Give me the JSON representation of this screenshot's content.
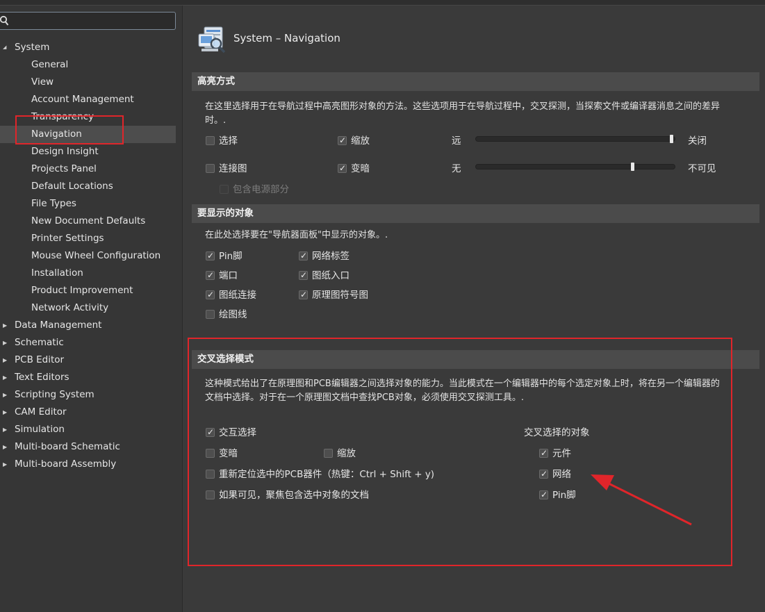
{
  "search": {
    "value": "",
    "placeholder": ""
  },
  "tree": [
    {
      "label": "System",
      "level": 0,
      "expanded": true,
      "selected": false
    },
    {
      "label": "General",
      "level": 1,
      "selected": false
    },
    {
      "label": "View",
      "level": 1,
      "selected": false
    },
    {
      "label": "Account Management",
      "level": 1,
      "selected": false
    },
    {
      "label": "Transparency",
      "level": 1,
      "selected": false
    },
    {
      "label": "Navigation",
      "level": 1,
      "selected": true
    },
    {
      "label": "Design Insight",
      "level": 1,
      "selected": false
    },
    {
      "label": "Projects Panel",
      "level": 1,
      "selected": false
    },
    {
      "label": "Default Locations",
      "level": 1,
      "selected": false
    },
    {
      "label": "File Types",
      "level": 1,
      "selected": false
    },
    {
      "label": "New Document Defaults",
      "level": 1,
      "selected": false
    },
    {
      "label": "Printer Settings",
      "level": 1,
      "selected": false
    },
    {
      "label": "Mouse Wheel Configuration",
      "level": 1,
      "selected": false
    },
    {
      "label": "Installation",
      "level": 1,
      "selected": false
    },
    {
      "label": "Product Improvement",
      "level": 1,
      "selected": false
    },
    {
      "label": "Network Activity",
      "level": 1,
      "selected": false
    },
    {
      "label": "Data Management",
      "level": 0,
      "expanded": false,
      "selected": false
    },
    {
      "label": "Schematic",
      "level": 0,
      "expanded": false,
      "selected": false
    },
    {
      "label": "PCB Editor",
      "level": 0,
      "expanded": false,
      "selected": false
    },
    {
      "label": "Text Editors",
      "level": 0,
      "expanded": false,
      "selected": false
    },
    {
      "label": "Scripting System",
      "level": 0,
      "expanded": false,
      "selected": false
    },
    {
      "label": "CAM Editor",
      "level": 0,
      "expanded": false,
      "selected": false
    },
    {
      "label": "Simulation",
      "level": 0,
      "expanded": false,
      "selected": false
    },
    {
      "label": "Multi-board Schematic",
      "level": 0,
      "expanded": false,
      "selected": false
    },
    {
      "label": "Multi-board Assembly",
      "level": 0,
      "expanded": false,
      "selected": false
    }
  ],
  "page": {
    "title": "System – Navigation",
    "icon": "navigation-settings-icon"
  },
  "highlight": {
    "title": "高亮方式",
    "desc": "在这里选择用于在导航过程中高亮图形对象的方法。这些选项用于在导航过程中，交叉探测，当探索文件或编译器消息之间的差异时。.",
    "select": {
      "label": "选择",
      "checked": false
    },
    "zoom": {
      "label": "缩放",
      "checked": true
    },
    "connect": {
      "label": "连接图",
      "checked": false
    },
    "dim": {
      "label": "变暗",
      "checked": true
    },
    "power": {
      "label": "包含电源部分",
      "checked": false,
      "disabled": true
    },
    "zoom_slider": {
      "min_label": "远",
      "max_label": "关闭",
      "level_pct": 100
    },
    "dim_slider": {
      "min_label": "无",
      "max_label": "不可见",
      "level_pct": 80
    }
  },
  "objects": {
    "title": "要显示的对象",
    "desc": "在此处选择要在\"导航器面板\"中显示的对象。.",
    "items": [
      {
        "label": "Pin脚",
        "checked": true
      },
      {
        "label": "网络标签",
        "checked": true
      },
      {
        "label": "端口",
        "checked": true
      },
      {
        "label": "图纸入口",
        "checked": true
      },
      {
        "label": "图纸连接",
        "checked": true
      },
      {
        "label": "原理图符号图",
        "checked": true
      },
      {
        "label": "绘图线",
        "checked": false
      }
    ]
  },
  "cross": {
    "title": "交叉选择模式",
    "desc": "这种模式给出了在原理图和PCB编辑器之间选择对象的能力。当此模式在一个编辑器中的每个选定对象上时，将在另一个编辑器的文档中选择。对于在一个原理图文档中查找PCB对象，必须使用交叉探测工具。.",
    "interactive": {
      "label": "交互选择",
      "checked": true
    },
    "dim": {
      "label": "变暗",
      "checked": false
    },
    "zoom": {
      "label": "缩放",
      "checked": false
    },
    "reposition": {
      "label": "重新定位选中的PCB器件（热键：Ctrl + Shift + y)",
      "checked": false
    },
    "focus": {
      "label": "如果可见，聚焦包含选中对象的文档",
      "checked": false
    },
    "targets_title": "交叉选择的对象",
    "targets": [
      {
        "label": "元件",
        "checked": true
      },
      {
        "label": "网络",
        "checked": true
      },
      {
        "label": "Pin脚",
        "checked": true
      }
    ]
  },
  "colors": {
    "annotation": "#e0252a",
    "background": "#3a3a3a",
    "section_bar": "#4b4b4b"
  }
}
